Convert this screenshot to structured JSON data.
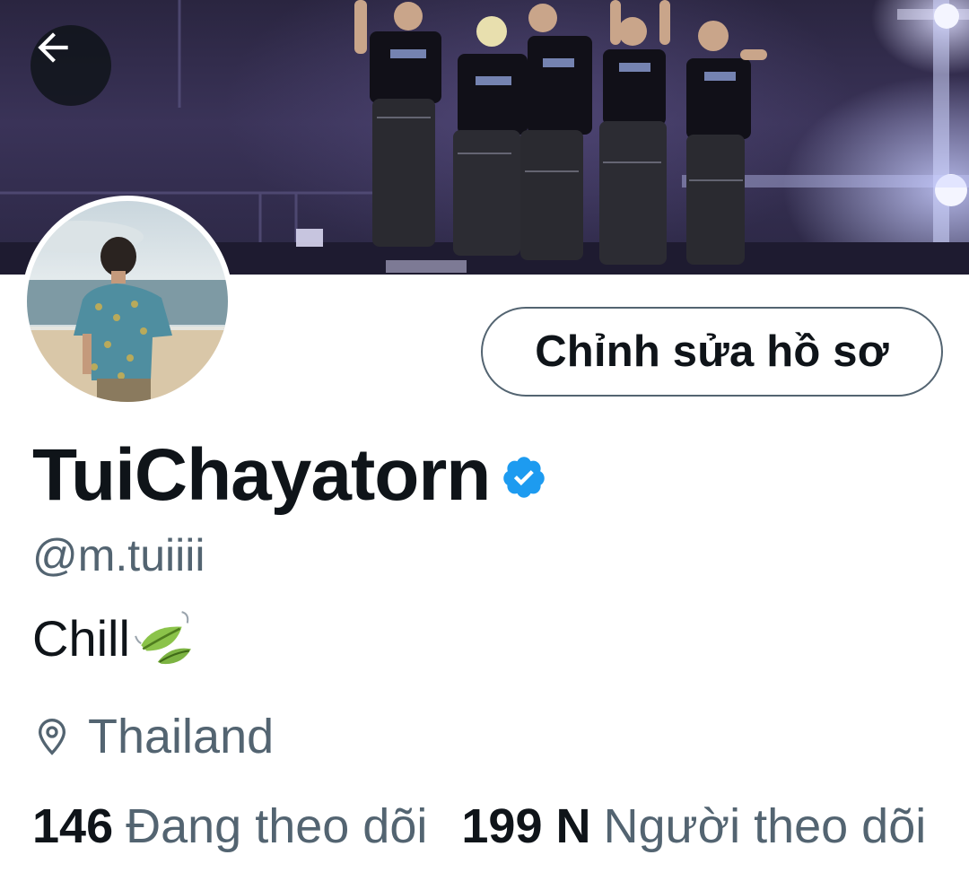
{
  "profile": {
    "display_name": "TuiChayatorn",
    "handle": "@m.tuiiii",
    "bio": "Chill",
    "location": "Thailand",
    "verified": true
  },
  "actions": {
    "edit_profile_label": "Chỉnh sửa hồ sơ"
  },
  "stats": {
    "following_count": "146",
    "following_label": "Đang theo dõi",
    "followers_count": "199 N",
    "followers_label": "Người theo dõi"
  },
  "icons": {
    "back": "arrow-left-icon",
    "verified": "verified-badge-icon",
    "bio_emoji": "leaf-emoji-icon",
    "location": "location-pin-icon"
  },
  "colors": {
    "text_primary": "#0f1419",
    "text_secondary": "#536471",
    "verified_blue": "#1d9bf0"
  }
}
